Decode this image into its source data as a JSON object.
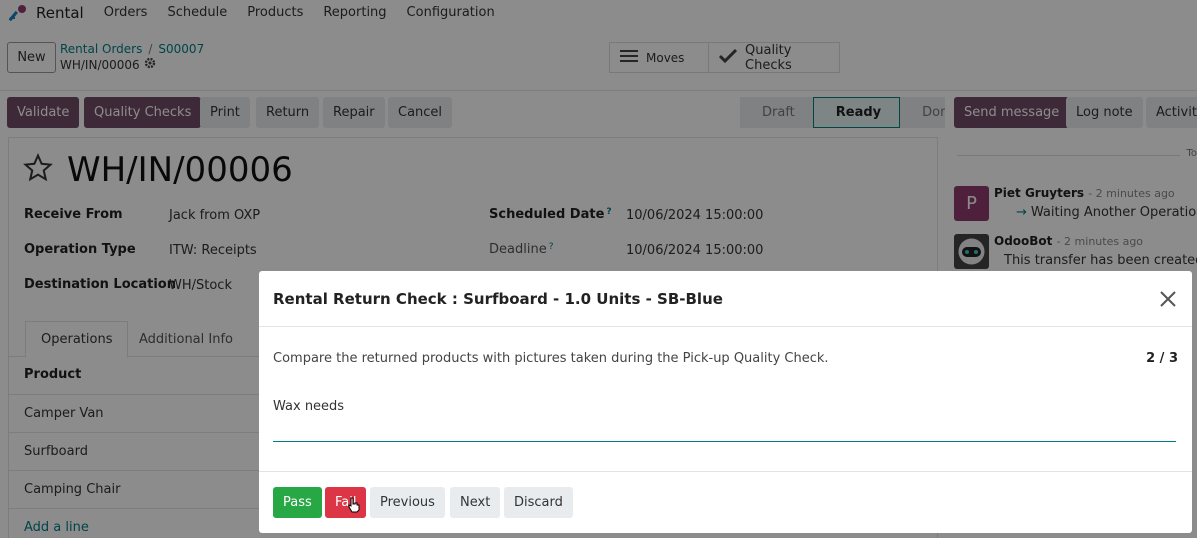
{
  "topnav": {
    "app_name": "Rental",
    "menu": [
      "Orders",
      "Schedule",
      "Products",
      "Reporting",
      "Configuration"
    ]
  },
  "control": {
    "new_label": "New",
    "breadcrumb": {
      "parent": "Rental Orders",
      "order": "S00007",
      "current": "WH/IN/00006"
    },
    "smart_buttons": {
      "moves": "Moves",
      "quality_checks": "Quality Checks"
    }
  },
  "statusbar": {
    "buttons": {
      "validate": "Validate",
      "quality_checks": "Quality Checks",
      "print": "Print",
      "return": "Return",
      "repair": "Repair",
      "cancel": "Cancel"
    },
    "stages": {
      "draft": "Draft",
      "ready": "Ready",
      "done": "Done"
    }
  },
  "form": {
    "title": "WH/IN/00006",
    "fields": {
      "receive_from_label": "Receive From",
      "receive_from_value": "Jack from OXP",
      "operation_type_label": "Operation Type",
      "operation_type_value": "ITW: Receipts",
      "destination_label": "Destination Location",
      "destination_value": "WH/Stock",
      "scheduled_label": "Scheduled Date",
      "scheduled_value": "10/06/2024 15:00:00",
      "deadline_label": "Deadline",
      "deadline_value": "10/06/2024 15:00:00",
      "help_mark": "?"
    },
    "tabs": {
      "operations": "Operations",
      "additional": "Additional Info"
    },
    "table": {
      "header": "Product",
      "rows": [
        "Camper Van",
        "Surfboard",
        "Camping Chair"
      ],
      "add_line": "Add a line"
    }
  },
  "chatter": {
    "buttons": {
      "send": "Send message",
      "log": "Log note",
      "activities": "Activit"
    },
    "today": "To",
    "messages": [
      {
        "avatar": "P",
        "author": "Piet Gruyters",
        "time": "- 2 minutes ago",
        "body": "Waiting Another Operation",
        "arrow": "→"
      },
      {
        "author": "OdooBot",
        "time": "- 2 minutes ago",
        "body": "This transfer has been created f"
      }
    ]
  },
  "modal": {
    "title": "Rental Return Check : Surfboard - 1.0 Units - SB-Blue",
    "instruction": "Compare the returned products with pictures taken during the Pick-up Quality Check.",
    "counter": "2 / 3",
    "note": "Wax needs",
    "buttons": {
      "pass": "Pass",
      "fail": "Fail",
      "previous": "Previous",
      "next": "Next",
      "discard": "Discard"
    }
  },
  "colors": {
    "primary": "#714b67",
    "teal": "#017e84",
    "pass": "#28a745",
    "fail": "#dc3545"
  }
}
